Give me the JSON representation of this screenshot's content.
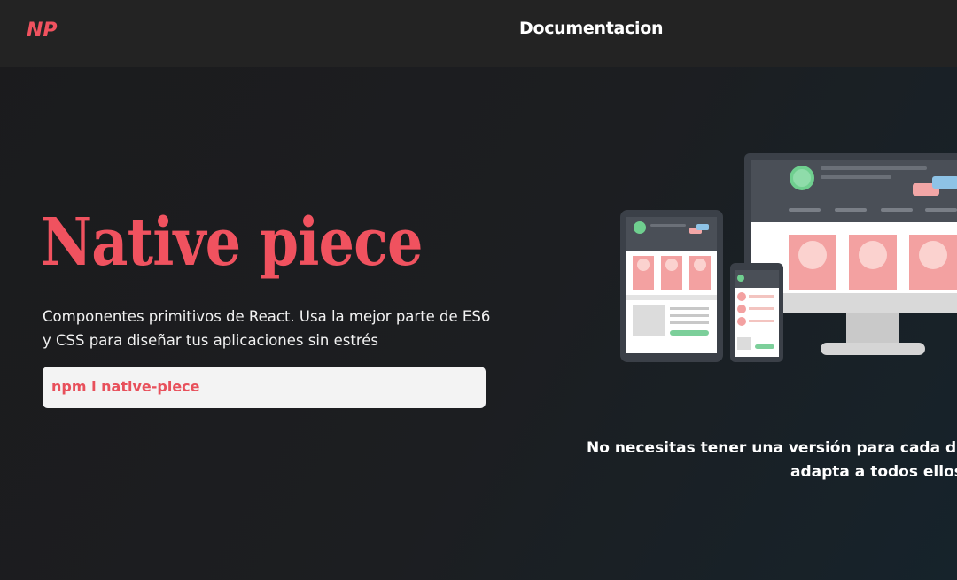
{
  "navbar": {
    "logo_text": "NP",
    "doc_link": "Documentacion"
  },
  "hero": {
    "title": "Native piece",
    "description": "Componentes primitivos de React. Usa la mejor parte de ES6 y CSS para diseñar tus aplicaciones sin estrés",
    "install_command": "npm i native-piece"
  },
  "devices_section": {
    "caption_line1": "No necesitas tener una versión para cada disp",
    "caption_line2": "adapta a todos ellos"
  },
  "colors": {
    "background": "#1c1d1f",
    "navbar": "#232323",
    "accent": "#f0525f",
    "text": "#ffffff",
    "input_background": "#f3f3f3"
  },
  "icons": {
    "logo": "np-logo-icon",
    "illustration": "responsive-devices-illustration"
  }
}
